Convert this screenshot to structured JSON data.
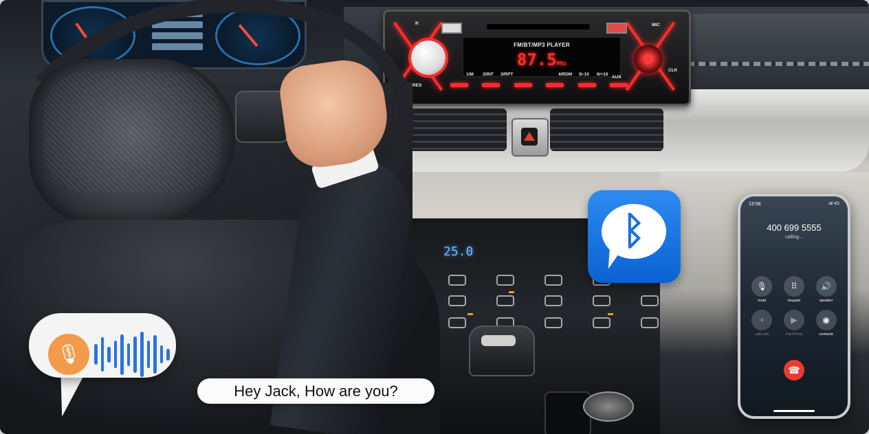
{
  "radio": {
    "mode_label": "FM/BT/MP3  PLAYER",
    "frequency": "87.5",
    "unit": "MHz",
    "top_labels": [
      "R",
      "MIC"
    ],
    "res_label": "RES",
    "aux_label": "AUX",
    "clk_label": "CLK",
    "preset_labels": [
      "1/M",
      "2/INT",
      "3/RPT",
      "4/RDM",
      "5/-10",
      "6/+10"
    ],
    "accent_color": "#ff2c2c"
  },
  "climate": {
    "temperature": "25.0"
  },
  "bluetooth": {
    "icon": "bluetooth-icon",
    "symbol": "ᛒ",
    "color": "#1a6fe0"
  },
  "phone": {
    "time": "13:58",
    "status": "all 4G",
    "number": "400 699 5555",
    "state": "calling...",
    "controls": [
      {
        "icon": "mute-icon",
        "glyph": "🎙",
        "label": "mute",
        "enabled": true
      },
      {
        "icon": "keypad-icon",
        "glyph": "⠿",
        "label": "keypad",
        "enabled": true
      },
      {
        "icon": "speaker-icon",
        "glyph": "🔊",
        "label": "speaker",
        "enabled": true
      },
      {
        "icon": "add-call-icon",
        "glyph": "+",
        "label": "add call",
        "enabled": false
      },
      {
        "icon": "facetime-icon",
        "glyph": "▶",
        "label": "FaceTime",
        "enabled": false
      },
      {
        "icon": "contacts-icon",
        "glyph": "◉",
        "label": "contacts",
        "enabled": true
      }
    ],
    "end_call_color": "#ee3b32"
  },
  "voice": {
    "mic_icon": "microphone-icon",
    "mic_glyph": "🎙",
    "mic_color": "#f39a4b",
    "wave_color": "#2a72e0",
    "wave_levels": [
      0.45,
      0.75,
      0.35,
      0.6,
      0.9,
      0.5,
      0.8,
      1.0,
      0.6,
      0.85,
      0.4,
      0.25
    ],
    "speech_text": "Hey Jack, How are you?"
  }
}
